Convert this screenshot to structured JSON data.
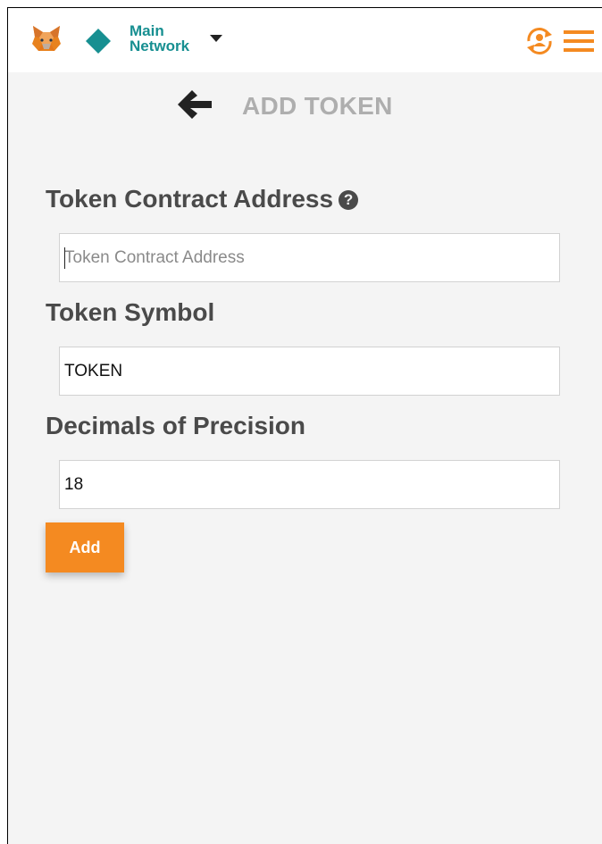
{
  "topbar": {
    "network_line1": "Main",
    "network_line2": "Network",
    "logo_icon": "metamask-fox-icon",
    "network_icon": "diamond-icon",
    "account_icon": "account-switch-icon",
    "menu_icon": "hamburger-menu-icon"
  },
  "header": {
    "back_icon": "arrow-left-icon",
    "title": "ADD TOKEN"
  },
  "form": {
    "contract_label": "Token Contract Address",
    "help_icon": "question-circle-icon",
    "contract_placeholder": "Token Contract Address",
    "contract_value": "",
    "symbol_label": "Token Symbol",
    "symbol_value": "TOKEN",
    "decimals_label": "Decimals of Precision",
    "decimals_value": "18",
    "add_label": "Add"
  },
  "colors": {
    "accent": "#f48a21",
    "network": "#178f91",
    "background": "#f4f4f4",
    "label": "#4a4a4a",
    "title": "#aeaeae"
  }
}
